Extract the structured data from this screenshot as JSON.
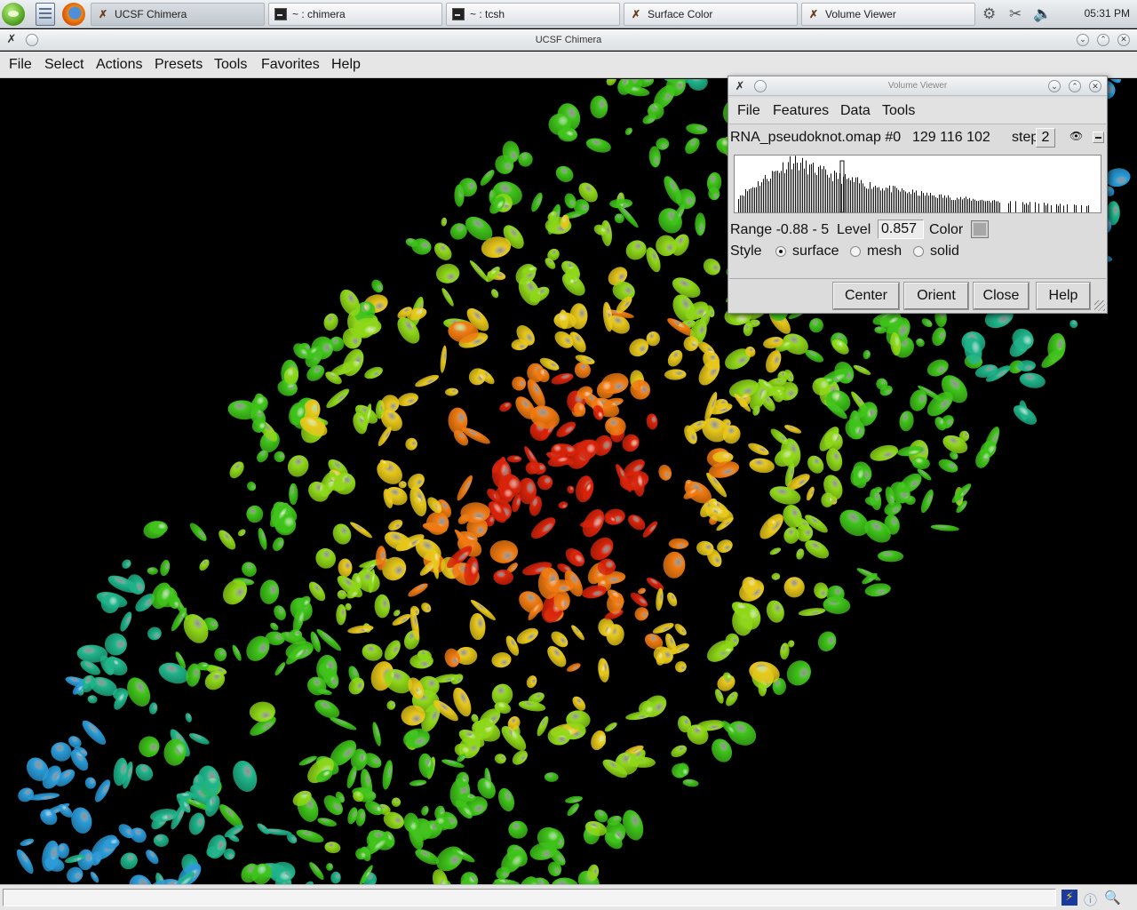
{
  "taskbar": {
    "tasks": [
      {
        "label": "UCSF Chimera"
      },
      {
        "label": "~ : chimera"
      },
      {
        "label": "~ : tcsh"
      },
      {
        "label": "Surface Color"
      },
      {
        "label": "Volume Viewer"
      }
    ],
    "clock": "05:31 PM"
  },
  "chimera": {
    "title": "UCSF Chimera",
    "menu": [
      "File",
      "Select",
      "Actions",
      "Presets",
      "Tools",
      "Favorites",
      "Help"
    ],
    "status_text": ""
  },
  "volume_viewer": {
    "title": "Volume Viewer",
    "menu": [
      "File",
      "Features",
      "Data",
      "Tools"
    ],
    "map_name": "RNA_pseudoknot.omap #0",
    "dimensions": "129 116 102",
    "step_label": "step",
    "step_value": "2",
    "range_text": "Range  -0.88 - 5",
    "level_label": "Level",
    "level_value": "0.857",
    "color_label": "Color",
    "color_value": "#a6a6a6",
    "style_label": "Style",
    "style_options": [
      "surface",
      "mesh",
      "solid"
    ],
    "style_selected": "surface",
    "buttons": [
      "Center",
      "Orient",
      "Close",
      "Help"
    ]
  },
  "colors": {
    "density_core": "#d8230a",
    "density_mid": "#e8c81a",
    "density_outer": "#3fc41a",
    "density_edge": "#2a9bd8",
    "background": "#000000"
  }
}
